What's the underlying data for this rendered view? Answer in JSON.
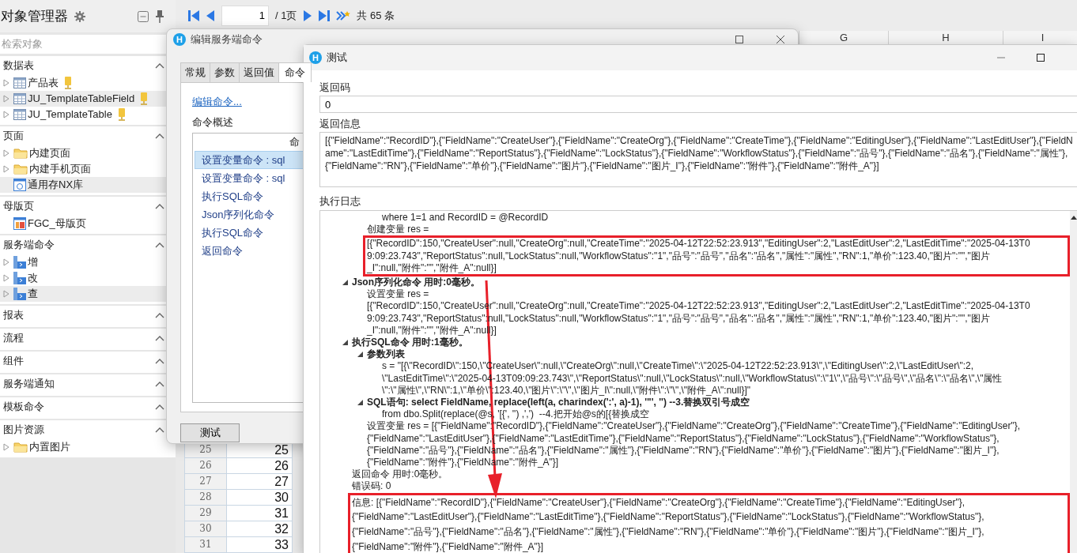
{
  "object_manager": {
    "title": "对象管理器",
    "search": {
      "placeholder": "检索对象"
    },
    "sections": [
      {
        "title": "数据表",
        "items": [
          {
            "label": "产品表",
            "kind": "table",
            "expandable": true,
            "selected": false
          },
          {
            "label": "JU_TemplateTableField",
            "kind": "table",
            "expandable": true,
            "selected": true
          },
          {
            "label": "JU_TemplateTable",
            "kind": "table",
            "expandable": true,
            "selected": false
          }
        ]
      },
      {
        "title": "页面",
        "items": [
          {
            "label": "内建页面",
            "kind": "folder",
            "expandable": true,
            "selected": false
          },
          {
            "label": "内建手机页面",
            "kind": "folder",
            "expandable": true,
            "selected": false
          },
          {
            "label": "通用存NX库",
            "kind": "page",
            "expandable": false,
            "selected": true
          }
        ]
      },
      {
        "title": "母版页",
        "items": [
          {
            "label": "FGC_母版页",
            "kind": "master",
            "expandable": false,
            "selected": false
          }
        ]
      },
      {
        "title": "服务端命令",
        "items": [
          {
            "label": "增",
            "kind": "command",
            "expandable": true,
            "selected": false
          },
          {
            "label": "改",
            "kind": "command",
            "expandable": true,
            "selected": false
          },
          {
            "label": "查",
            "kind": "command",
            "expandable": true,
            "selected": true
          }
        ]
      },
      {
        "title": "报表"
      },
      {
        "title": "流程"
      },
      {
        "title": "组件"
      },
      {
        "title": "服务端通知"
      },
      {
        "title": "模板命令"
      },
      {
        "title": "图片资源",
        "items": [
          {
            "label": "内置图片",
            "kind": "folder",
            "expandable": true,
            "selected": false
          }
        ]
      }
    ]
  },
  "pager": {
    "page": "1",
    "pages": "/ 1页",
    "count": "共 65 条"
  },
  "sheet": {
    "columns": [
      "G",
      "H",
      "I"
    ],
    "rows": [
      {
        "number": "25",
        "value": "25"
      },
      {
        "number": "26",
        "value": "26"
      },
      {
        "number": "27",
        "value": "27"
      },
      {
        "number": "28",
        "value": "30"
      },
      {
        "number": "29",
        "value": "31"
      },
      {
        "number": "30",
        "value": "32"
      },
      {
        "number": "31",
        "value": "33"
      }
    ]
  },
  "edit_dialog": {
    "logo": "H",
    "title": "编辑服务端命令",
    "tabs": [
      {
        "label": "常规",
        "selected": false
      },
      {
        "label": "参数",
        "selected": false
      },
      {
        "label": "返回值",
        "selected": false
      },
      {
        "label": "命令",
        "selected": true
      }
    ],
    "link": "编辑命令...",
    "summary_label": "命令概述",
    "list_header": "命",
    "commands": [
      {
        "label": "设置变量命令 : sql",
        "selected": true
      },
      {
        "label": "设置变量命令 : sql",
        "selected": false
      },
      {
        "label": "执行SQL命令",
        "selected": false
      },
      {
        "label": "Json序列化命令",
        "selected": false
      },
      {
        "label": "执行SQL命令",
        "selected": false
      },
      {
        "label": "返回命令",
        "selected": false
      }
    ],
    "test_button": "测试"
  },
  "test_dialog": {
    "logo": "H",
    "title": "测试",
    "return_code_label": "返回码",
    "return_code": "0",
    "return_info_label": "返回信息",
    "return_info": "[{\"FieldName\":\"RecordID\"},{\"FieldName\":\"CreateUser\"},{\"FieldName\":\"CreateOrg\"},{\"FieldName\":\"CreateTime\"},{\"FieldName\":\"EditingUser\"},{\"FieldName\":\"LastEditUser\"},{\"FieldName\":\"LastEditTime\"},{\"FieldName\":\"ReportStatus\"},{\"FieldName\":\"LockStatus\"},{\"FieldName\":\"WorkflowStatus\"},{\"FieldName\":\"品号\"},{\"FieldName\":\"品名\"},{\"FieldName\":\"属性\"},{\"FieldName\":\"RN\"},{\"FieldName\":\"单价\"},{\"FieldName\":\"图片\"},{\"FieldName\":\"图片_I\"},{\"FieldName\":\"附件\"},{\"FieldName\":\"附件_A\"}]",
    "log_label": "执行日志",
    "log": [
      {
        "children": [
          {
            "children": [
              {
                "kind": "text",
                "text": "where 1=1 and RecordID = @RecordID"
              }
            ]
          },
          {
            "kind": "text",
            "text": "创建变量 res =",
            "value": "[{\"RecordID\":150,\"CreateUser\":null,\"CreateOrg\":null,\"CreateTime\":\"2025-04-12T22:52:23.913\",\"EditingUser\":2,\"LastEditUser\":2,\"LastEditTime\":\"2025-04-13T0\n9:09:23.743\",\"ReportStatus\":null,\"LockStatus\":null,\"WorkflowStatus\":\"1\",\"品号\":\"品号\",\"品名\":\"品名\",\"属性\":\"属性\",\"RN\":1,\"单价\":123.40,\"图片\":\"\",\"图片\n_I\":null,\"附件\":\"\",\"附件_A\":null}]",
            "highlighted": true
          }
        ]
      },
      {
        "kind": "command",
        "text": "Json序列化命令 用时:0毫秒。",
        "expanded": true,
        "children": [
          {
            "kind": "text",
            "text": "设置变量 res =",
            "value": "[{\"RecordID\":150,\"CreateUser\":null,\"CreateOrg\":null,\"CreateTime\":\"2025-04-12T22:52:23.913\",\"EditingUser\":2,\"LastEditUser\":2,\"LastEditTime\":\"2025-04-13T0\n9:09:23.743\",\"ReportStatus\":null,\"LockStatus\":null,\"WorkflowStatus\":\"1\",\"品号\":\"品号\",\"品名\":\"品名\",\"属性\":\"属性\",\"RN\":1,\"单价\":123.40,\"图片\":\"\",\"图片\n_I\":null,\"附件\":\"\",\"附件_A\":null}]",
            "highlighted": false
          }
        ]
      },
      {
        "kind": "command",
        "text": "执行SQL命令 用时:1毫秒。",
        "expanded": true,
        "children": [
          {
            "kind": "command",
            "text": "参数列表",
            "expanded": true,
            "children": [
              {
                "kind": "text",
                "text": "s = \"[{\\\"RecordID\\\":150,\\\"CreateUser\\\":null,\\\"CreateOrg\\\":null,\\\"CreateTime\\\":\\\"2025-04-12T22:52:23.913\\\",\\\"EditingUser\\\":2,\\\"LastEditUser\\\":2,\n\\\"LastEditTime\\\":\\\"2025-04-13T09:09:23.743\\\",\\\"ReportStatus\\\":null,\\\"LockStatus\\\":null,\\\"WorkflowStatus\\\":\\\"1\\\",\\\"品号\\\":\\\"品号\\\",\\\"品名\\\":\\\"品名\\\",\\\"属性\n\\\":\\\"属性\\\",\\\"RN\\\":1,\\\"单价\\\":123.40,\\\"图片\\\":\\\"\\\",\\\"图片_I\\\":null,\\\"附件\\\":\\\"\\\",\\\"附件_A\\\":null}]\""
              }
            ]
          },
          {
            "kind": "command",
            "text": "SQL语句: select FieldName, replace(left(a, charindex(':', a)-1), '\"', '') --3.替换双引号成空",
            "expanded": true,
            "children": [
              {
                "kind": "text",
                "text": "from dbo.Split(replace(@s, '[{', '') ,',')  --4.把开始@s的[{替换成空"
              }
            ]
          },
          {
            "kind": "text",
            "text": "设置变量 res = [{\"FieldName\":\"RecordID\"},{\"FieldName\":\"CreateUser\"},{\"FieldName\":\"CreateOrg\"},{\"FieldName\":\"CreateTime\"},{\"FieldName\":\"EditingUser\"},\n{\"FieldName\":\"LastEditUser\"},{\"FieldName\":\"LastEditTime\"},{\"FieldName\":\"ReportStatus\"},{\"FieldName\":\"LockStatus\"},{\"FieldName\":\"WorkflowStatus\"},\n{\"FieldName\":\"品号\"},{\"FieldName\":\"品名\"},{\"FieldName\":\"属性\"},{\"FieldName\":\"RN\"},{\"FieldName\":\"单价\"},{\"FieldName\":\"图片\"},{\"FieldName\":\"图片_I\"},\n{\"FieldName\":\"附件\"},{\"FieldName\":\"附件_A\"}]"
          }
        ]
      },
      {
        "kind": "text",
        "text": "返回命令 用时:0毫秒。"
      },
      {
        "kind": "text",
        "text": "错误码: 0"
      },
      {
        "kind": "text",
        "text": "信息: [{\"FieldName\":\"RecordID\"},{\"FieldName\":\"CreateUser\"},{\"FieldName\":\"CreateOrg\"},{\"FieldName\":\"CreateTime\"},{\"FieldName\":\"EditingUser\"},\n{\"FieldName\":\"LastEditUser\"},{\"FieldName\":\"LastEditTime\"},{\"FieldName\":\"ReportStatus\"},{\"FieldName\":\"LockStatus\"},{\"FieldName\":\"WorkflowStatus\"},\n{\"FieldName\":\"品号\"},{\"FieldName\":\"品名\"},{\"FieldName\":\"属性\"},{\"FieldName\":\"RN\"},{\"FieldName\":\"单价\"},{\"FieldName\":\"图片\"},{\"FieldName\":\"图片_I\"},\n{\"FieldName\":\"附件\"},{\"FieldName\":\"附件_A\"}]",
        "highlighted": true
      }
    ]
  }
}
